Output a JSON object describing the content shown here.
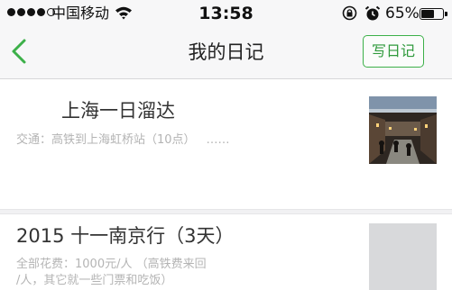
{
  "status_bar": {
    "signal_dots": 5,
    "signal_filled": 4,
    "carrier": "中国移动",
    "time": "13:58",
    "battery_percent": "65%",
    "battery_level": 0.65
  },
  "nav": {
    "back_icon": "chevron-left-icon",
    "title": "我的日记",
    "write_button": "写日记"
  },
  "diary_entries": [
    {
      "title": "上海一日溜达",
      "summary": "交通：高铁到上海虹桥站（10点）",
      "ellipsis": "……"
    },
    {
      "title": "2015 十一南京行（3天）",
      "summary_lines": [
        "全部花费：1000元/人 （高铁费来回",
        "/人，其它就一些门票和吃饭）"
      ]
    }
  ],
  "colors": {
    "accent_green": "#3cb049",
    "nav_background": "#f7f7f8",
    "summary_gray": "#b4b4b4"
  }
}
